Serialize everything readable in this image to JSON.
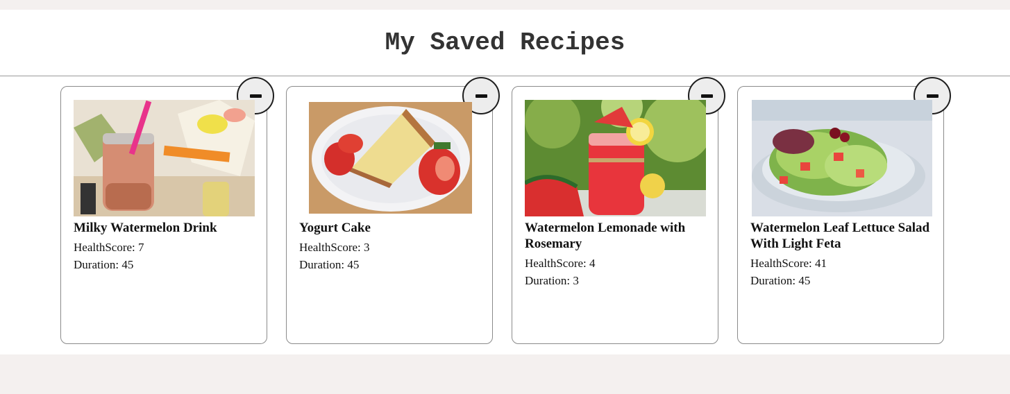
{
  "page": {
    "title": "My Saved Recipes"
  },
  "recipes": [
    {
      "title": "Milky Watermelon Drink",
      "health_label": "HealthScore: 7",
      "duration_label": "Duration: 45",
      "image": "watermelon-milk-drink-photo"
    },
    {
      "title": "Yogurt Cake",
      "health_label": "HealthScore: 3",
      "duration_label": "Duration: 45",
      "image": "yogurt-cake-photo"
    },
    {
      "title": "Watermelon Lemonade with Rosemary",
      "health_label": "HealthScore: 4",
      "duration_label": "Duration: 3",
      "image": "watermelon-lemonade-photo"
    },
    {
      "title": "Watermelon Leaf Lettuce Salad With Light Feta",
      "health_label": "HealthScore: 41",
      "duration_label": "Duration: 45",
      "image": "watermelon-salad-photo"
    }
  ],
  "remove_icon": "minus-icon",
  "colors": {
    "page_bg": "#f4f0ef",
    "panel_bg": "#ffffff",
    "title_text": "#333333",
    "button_bg": "#ededed"
  }
}
